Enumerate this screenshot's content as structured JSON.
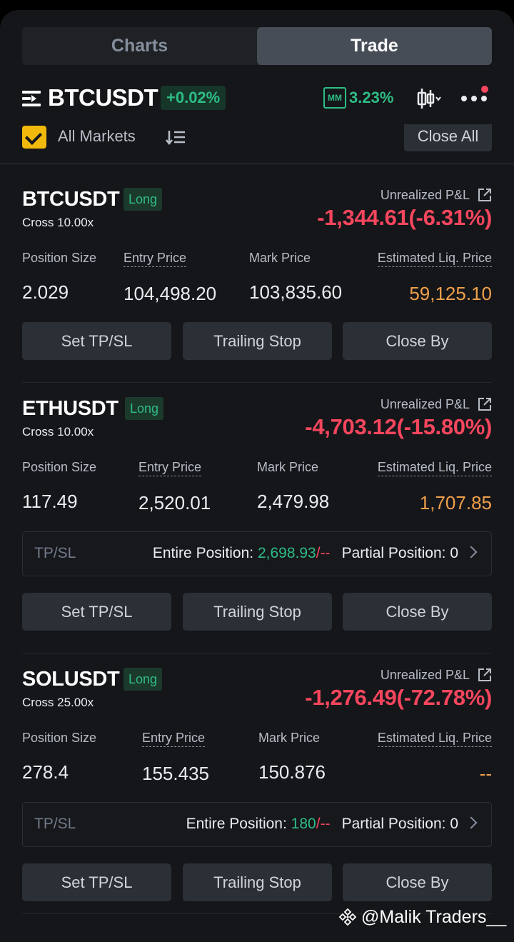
{
  "tabs": [
    {
      "label": "Charts",
      "active": false
    },
    {
      "label": "Trade",
      "active": true
    }
  ],
  "header": {
    "symbol": "BTCUSDT",
    "change": "+0.02%",
    "mm_icon_text": "MM",
    "mm_value": "3.23%",
    "icons": [
      "menu-icon",
      "candlestick-icon",
      "more-icon"
    ]
  },
  "filter": {
    "all_markets_label": "All Markets",
    "all_markets_checked": true,
    "close_all_label": "Close All"
  },
  "labels": {
    "pnl": "Unrealized P&L",
    "position_size": "Position Size",
    "entry_price": "Entry Price",
    "mark_price": "Mark Price",
    "liq_price": "Estimated Liq. Price",
    "tpsl": "TP/SL",
    "entire": "Entire Position:",
    "partial": "Partial Position:",
    "set_tpsl": "Set TP/SL",
    "trailing": "Trailing Stop",
    "close_by": "Close By"
  },
  "positions": [
    {
      "symbol": "BTCUSDT",
      "side": "Long",
      "margin": "Cross 10.00x",
      "pnl": "-1,344.61(-6.31%)",
      "size": "2.029",
      "entry": "104,498.20",
      "mark": "103,835.60",
      "liq": "59,125.10"
    },
    {
      "symbol": "ETHUSDT",
      "side": "Long",
      "margin": "Cross 10.00x",
      "pnl": "-4,703.12(-15.80%)",
      "size": "117.49",
      "entry": "2,520.01",
      "mark": "2,479.98",
      "liq": "1,707.85",
      "tpsl": {
        "tp": "2,698.93",
        "slash": "/",
        "sl": "--",
        "partial": "0"
      }
    },
    {
      "symbol": "SOLUSDT",
      "side": "Long",
      "margin": "Cross 25.00x",
      "pnl": "-1,276.49(-72.78%)",
      "size": "278.4",
      "entry": "155.435",
      "mark": "150.876",
      "liq": "--",
      "tpsl": {
        "tp": "180",
        "slash": "/",
        "sl": "--",
        "partial": "0"
      }
    }
  ],
  "watermark": "@Malik Traders__",
  "colors": {
    "green": "#2ebd85",
    "red": "#f6465d",
    "orange": "#f0a04b",
    "yellow": "#f0b90b",
    "background": "#15161a",
    "button": "#2b2f36"
  }
}
